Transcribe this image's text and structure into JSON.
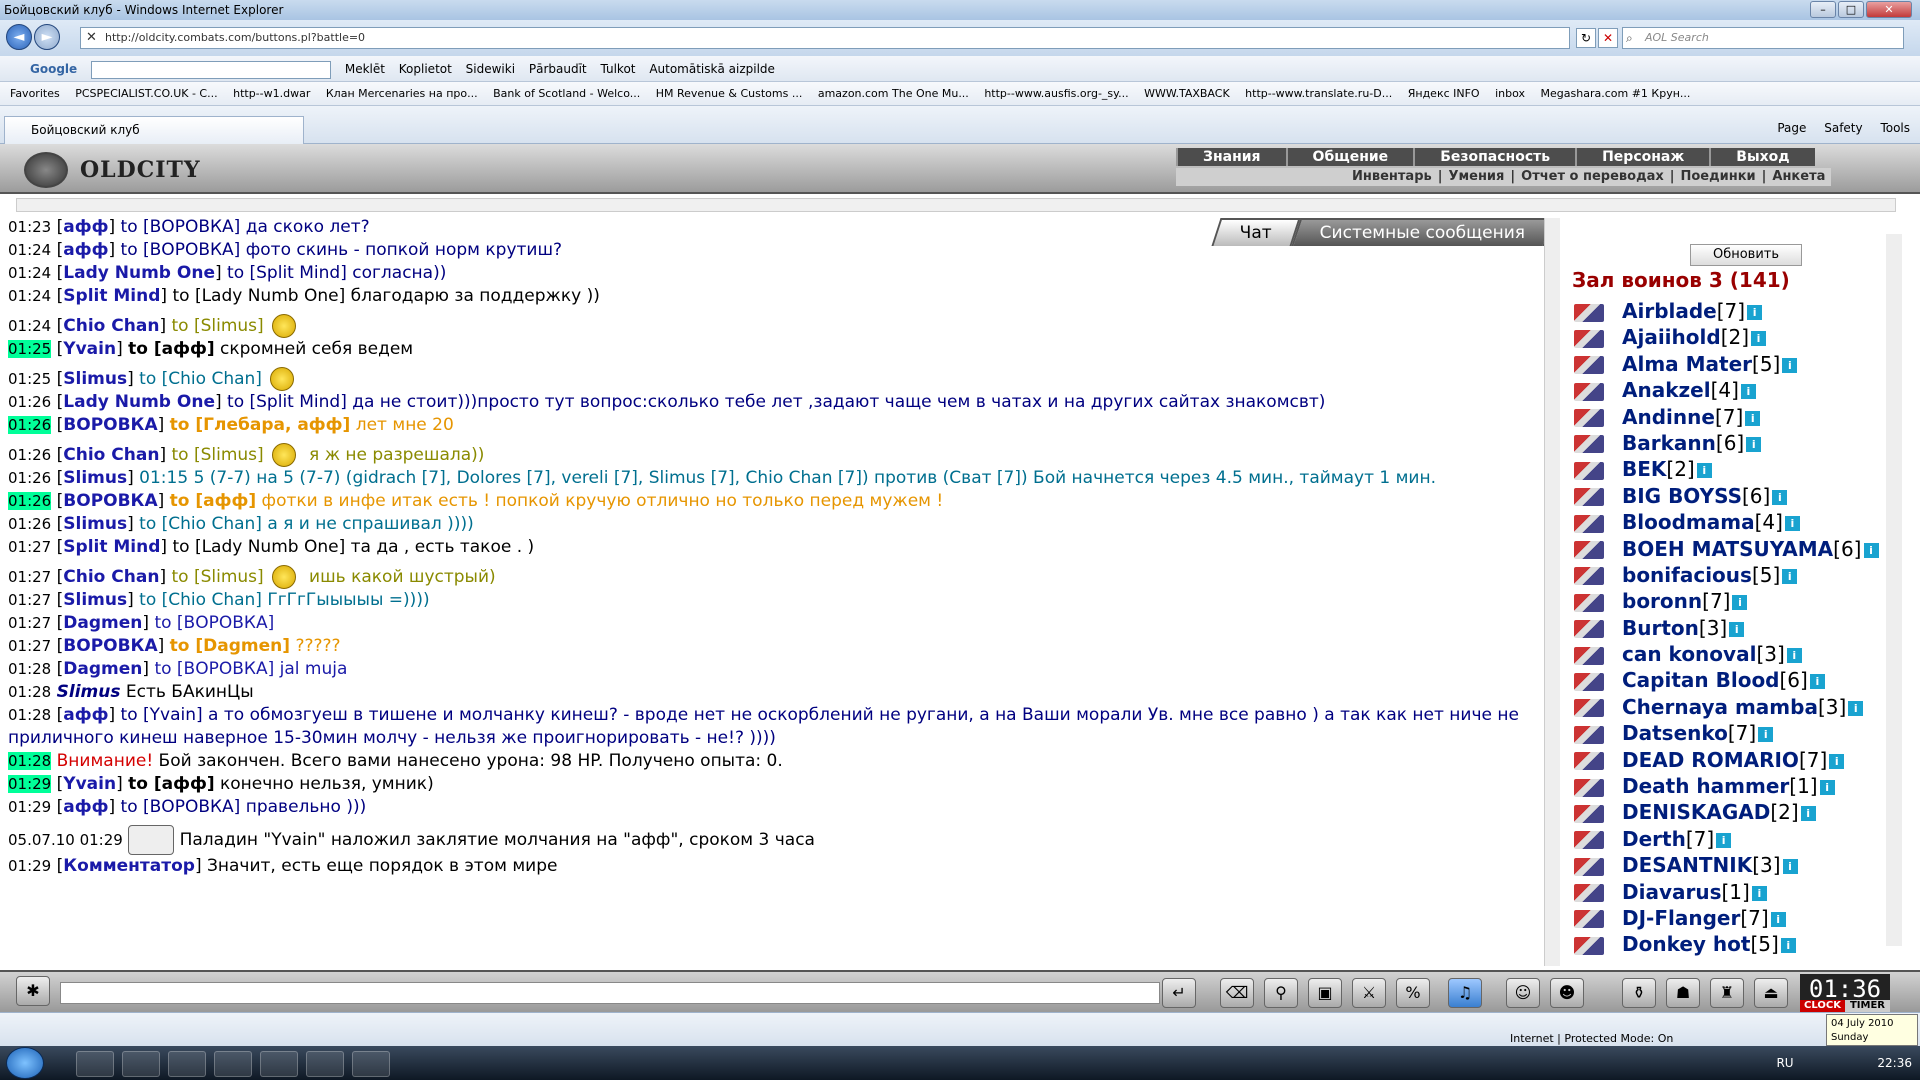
{
  "window": {
    "title": "Бойцовский клуб - Windows Internet Explorer"
  },
  "browser": {
    "url": "http://oldcity.combats.com/buttons.pl?battle=0",
    "search_placeholder": "AOL Search",
    "toolbar": [
      "Google",
      "Meklēt",
      "Koplietot",
      "Sidewiki",
      "Pārbaudīt",
      "Tulkot",
      "Automātiskā aizpilde"
    ],
    "favorites": [
      "Favorites",
      "PCSPECIALIST.CO.UK - C...",
      "http--w1.dwar",
      "Клан Mercenaries на про...",
      "Bank of Scotland - Welco...",
      "HM Revenue & Customs ...",
      "amazon.com The One Mu...",
      "http--www.ausfis.org-_sy...",
      "WWW.TAXBACK",
      "http--www.translate.ru-D...",
      "Яндекс INFO",
      "inbox",
      "Megashara.com #1 Крун..."
    ],
    "tab_title": "Бойцовский клуб",
    "command_bar": [
      "Page",
      "Safety",
      "Tools"
    ]
  },
  "game": {
    "logo": "OLDCITY",
    "menu_top": [
      "Знания",
      "Общение",
      "Безопасность",
      "Персонаж",
      "Выход"
    ],
    "menu_sub": [
      "Инвентарь",
      "Умения",
      "Отчет о переводах",
      "Поединки",
      "Анкета"
    ],
    "chat_tabs": [
      "Чат",
      "Системные сообщения"
    ],
    "chat": [
      {
        "t": "01:23",
        "name": "афф",
        "to": "to [ВОРОВКА]",
        "msg": " да скоко лет?",
        "c": "navy"
      },
      {
        "t": "01:24",
        "name": "афф",
        "to": "to [ВОРОВКА]",
        "msg": " фото скинь - попкой норм крутиш?",
        "c": "navy"
      },
      {
        "t": "01:24",
        "name": "Lady Numb One",
        "to": "to [Split Mind]",
        "msg": " согласна))",
        "c": "navy"
      },
      {
        "t": "01:24",
        "name": "Split Mind",
        "to": "to [Lady Numb One]",
        "msg": " благодарю за поддержку ))",
        "c": "black"
      },
      {
        "t": "01:24",
        "name": "Chio Chan",
        "to": "to [Slimus]",
        "msg": "",
        "c": "olive",
        "smile": true
      },
      {
        "t": "01:25",
        "hl": true,
        "name": "Yvain",
        "to": "to [афф]",
        "msg": " скромней себя ведем",
        "c": "bold"
      },
      {
        "t": "01:25",
        "name": "Slimus",
        "to": "to [Chio Chan]",
        "msg": "",
        "c": "teal",
        "smile": true
      },
      {
        "t": "01:26",
        "name": "Lady Numb One",
        "to": "to [Split Mind]",
        "msg": " да не стоит)))просто тут вопрос:сколько тебе лет ,задают чаще чем в чатах и на других сайтах знакомсвт)",
        "c": "navy"
      },
      {
        "t": "01:26",
        "hl": true,
        "name": "ВОРОВКА",
        "to": "to [Глебара, афф]",
        "msg": " лет мне 20",
        "c": "orange"
      },
      {
        "t": "01:26",
        "name": "Chio Chan",
        "to": "to [Slimus]",
        "msg": "  я ж не разрешала))",
        "c": "olive",
        "smile": true
      },
      {
        "t": "01:26",
        "name": "Slimus",
        "to": "",
        "msg": " 01:15 5 (7-7) на 5 (7-7) (gidrach [7], Dolores [7], vereli [7], Slimus [7], Chio Chan [7]) против (Сват [7]) Бой начнется через 4.5 мин., таймаут 1 мин.",
        "c": "teal",
        "wrap": true
      },
      {
        "t": "01:26",
        "hl": true,
        "name": "ВОРОВКА",
        "to": "to [афф]",
        "msg": " фотки в инфе итак есть ! попкой кручую отлично но только перед мужем !",
        "c": "orange"
      },
      {
        "t": "01:26",
        "name": "Slimus",
        "to": "to [Chio Chan]",
        "msg": " а я и не спрашивал ))))",
        "c": "teal"
      },
      {
        "t": "01:27",
        "name": "Split Mind",
        "to": "to [Lady Numb One]",
        "msg": " та да , есть такое . )",
        "c": "black"
      },
      {
        "t": "01:27",
        "name": "Chio Chan",
        "to": "to [Slimus]",
        "msg": "  ишь какой шустрый)",
        "c": "olive",
        "smile": true
      },
      {
        "t": "01:27",
        "name": "Slimus",
        "to": "to [Chio Chan]",
        "msg": " ГгГгГыыыыы =))))",
        "c": "teal"
      },
      {
        "t": "01:27",
        "name": "Dagmen",
        "to": "to [ВОРОВКА]",
        "msg": "",
        "c": "blue"
      },
      {
        "t": "01:27",
        "name": "ВОРОВКА",
        "to": "to [Dagmen]",
        "msg": " ?????",
        "c": "orange"
      },
      {
        "t": "01:28",
        "name": "Dagmen",
        "to": "to [ВОРОВКА]",
        "msg": " jal muja",
        "c": "blue"
      },
      {
        "t": "01:28",
        "italic": "Slimus",
        "msg": " Есть БАкинЦы",
        "c": "black"
      },
      {
        "t": "01:28",
        "name": "афф",
        "to": "to [Yvain]",
        "msg": " а то обмозгуеш в тишене и молчанку кинеш? - вроде нет не оскорблений не ругани, а на Ваши морали Ув. мне все равно ) а так как нет ниче не приличного кинеш наверное 15-30мин молчу - нельзя же проигнорировать - не!? ))))",
        "c": "navy",
        "wrap": true
      },
      {
        "t": "01:28",
        "hl": true,
        "warn": "Внимание!",
        "msg": " Бой закончен. Всего вами нанесено урона: 98 HP. Получено опыта: 0.",
        "c": "black"
      },
      {
        "t": "01:29",
        "hl": true,
        "name": "Yvain",
        "to": "to [афф]",
        "msg": " конечно нельзя, умник)",
        "c": "bold"
      },
      {
        "t": "01:29",
        "name": "афф",
        "to": "to [ВОРОВКА]",
        "msg": " правельно )))",
        "c": "navy"
      },
      {
        "t": "05.07.10 01:29",
        "msg": " Паладин \"Yvain\" наложил заклятие молчания на \"афф\", сроком 3 часа",
        "c": "black",
        "lock": true
      },
      {
        "t": "01:29",
        "name": "Комментатор",
        "to": "",
        "msg": " Значит, есть еще порядок в этом мире",
        "c": "black"
      }
    ],
    "side": {
      "refresh": "Обновить",
      "hall": "Зал воинов 3 (141)",
      "players": [
        {
          "n": "Airblade",
          "l": "[7]"
        },
        {
          "n": "Ajaiihold",
          "l": "[2]"
        },
        {
          "n": "Alma Mater",
          "l": "[5]"
        },
        {
          "n": "Anakzel",
          "l": "[4]"
        },
        {
          "n": "Andinne",
          "l": "[7]"
        },
        {
          "n": "Barkann",
          "l": "[6]"
        },
        {
          "n": "BEK",
          "l": "[2]"
        },
        {
          "n": "BIG BOYSS",
          "l": "[6]"
        },
        {
          "n": "Bloodmama",
          "l": "[4]"
        },
        {
          "n": "BOEH MATSUYAMA",
          "l": "[6]"
        },
        {
          "n": "bonifacious",
          "l": "[5]"
        },
        {
          "n": "boronn",
          "l": "[7]"
        },
        {
          "n": "Burton",
          "l": "[3]"
        },
        {
          "n": "can konoval",
          "l": "[3]"
        },
        {
          "n": "Capitan Blood",
          "l": "[6]"
        },
        {
          "n": "Chernaya mamba",
          "l": "[3]"
        },
        {
          "n": "Datsenko",
          "l": "[7]"
        },
        {
          "n": "DEAD ROMARIO",
          "l": "[7]"
        },
        {
          "n": "Death hammer",
          "l": "[1]"
        },
        {
          "n": "DENISKAGAD",
          "l": "[2]"
        },
        {
          "n": "Derth",
          "l": "[7]"
        },
        {
          "n": "DESANTNIK",
          "l": "[3]"
        },
        {
          "n": "Diavarus",
          "l": "[1]"
        },
        {
          "n": "DJ-Flanger",
          "l": "[7]"
        },
        {
          "n": "Donkey hot",
          "l": "[5]"
        }
      ]
    },
    "clock": {
      "time": "01:36",
      "clock_label": "CLOCK",
      "timer_label": "TIMER"
    }
  },
  "statusbar": {
    "text": "Internet | Protected Mode: On"
  },
  "taskbar": {
    "lang": "RU",
    "time": "22:36",
    "date": "04 July 2010",
    "day": "Sunday"
  }
}
